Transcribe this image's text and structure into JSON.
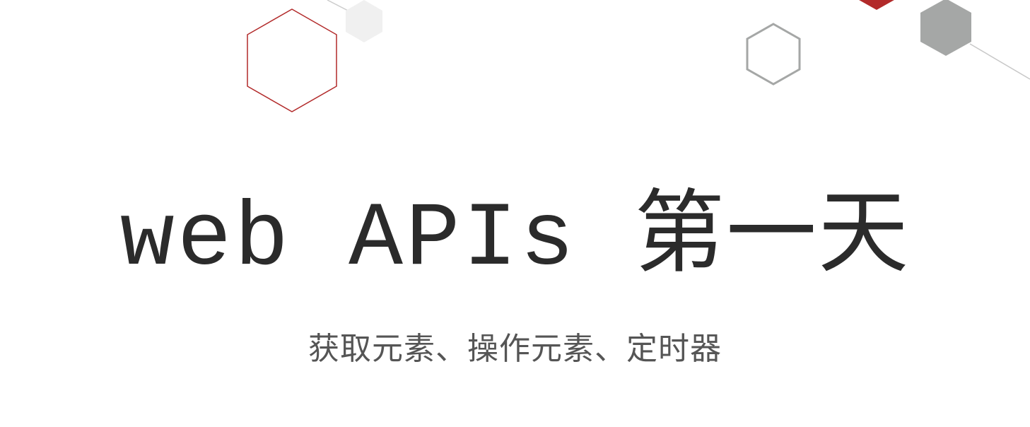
{
  "slide": {
    "title_latin": "web APIs ",
    "title_cjk": "第一天",
    "subtitle": "获取元素、操作元素、定时器"
  },
  "decor": {
    "accent_red": "#b22a2a",
    "hex_gray": "#a5a7a6",
    "hex_light": "#f0f0f0",
    "line_gray": "#c8c8c8"
  }
}
